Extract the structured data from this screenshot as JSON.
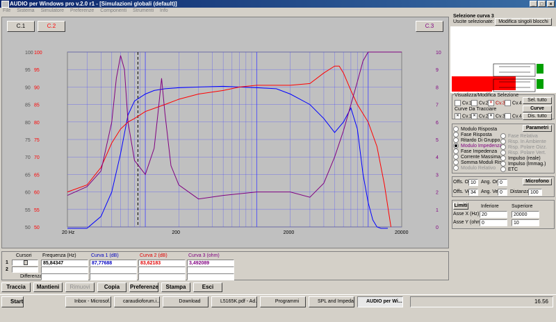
{
  "window": {
    "title": "AUDIO per Windows pro v.2.0 r1 - [Simulazioni globali (default)]"
  },
  "menu": [
    "File",
    "Sistema",
    "Simulatore",
    "Preferenze",
    "Componenti",
    "Strumenti",
    "Info"
  ],
  "legend": {
    "c1": "C.1",
    "c2": "C.2",
    "c3": "C.3"
  },
  "chart_data": {
    "type": "line",
    "x_scale": "log",
    "xlim": [
      20,
      20000
    ],
    "xticks": [
      "20 Hz",
      "200",
      "2000",
      "20000"
    ],
    "ylim_left": [
      50,
      100
    ],
    "ylim_right": [
      0,
      10
    ],
    "yticks_left_gray": [
      "100",
      "95",
      "90",
      "85",
      "80",
      "75",
      "70",
      "65",
      "60",
      "55",
      "50"
    ],
    "yticks_left_red": [
      "100",
      "95",
      "90",
      "85",
      "80",
      "75",
      "70",
      "65",
      "60",
      "55",
      "50"
    ],
    "yticks_right": [
      "10",
      "9",
      "8",
      "7",
      "6",
      "5",
      "4",
      "3",
      "2",
      "1",
      "0"
    ],
    "cursor_x": 85.84,
    "grid": true,
    "series": [
      {
        "name": "Curva 1 (dB)",
        "color": "#0000ff",
        "axis": "left",
        "x": [
          20,
          30,
          40,
          50,
          60,
          70,
          80,
          100,
          120,
          150,
          200,
          300,
          500,
          700,
          1000,
          1500,
          2000,
          3000,
          4000,
          5000,
          6000,
          7000,
          8000,
          9000,
          10000,
          11000,
          12000,
          13000,
          15000
        ],
        "y": [
          47,
          49,
          53,
          60,
          71,
          82,
          86,
          88,
          89,
          89.5,
          89.8,
          90,
          90.2,
          90,
          89.8,
          89.5,
          88,
          85,
          81,
          77,
          80,
          84,
          78,
          65,
          57,
          52,
          50,
          49,
          48
        ]
      },
      {
        "name": "Curva 2 (dB)",
        "color": "#ff0000",
        "axis": "left",
        "x": [
          20,
          30,
          40,
          50,
          60,
          70,
          80,
          100,
          150,
          200,
          300,
          500,
          700,
          1000,
          1500,
          2000,
          3000,
          4000,
          5000,
          5500,
          6000,
          7000,
          8000,
          10000,
          12000,
          14000,
          16000
        ],
        "y": [
          60,
          62,
          67,
          74,
          78,
          80,
          81,
          83,
          85,
          86.5,
          88,
          89,
          90,
          90.5,
          90.5,
          90.5,
          91,
          94,
          96,
          96,
          94,
          89,
          85,
          80,
          73,
          62,
          50
        ]
      },
      {
        "name": "Curva 3 (ohm)",
        "color": "#800080",
        "axis": "right",
        "x": [
          20,
          30,
          40,
          50,
          55,
          60,
          65,
          70,
          80,
          100,
          120,
          130,
          140,
          150,
          170,
          200,
          300,
          500,
          1000,
          2000,
          3000,
          4000,
          5000,
          6000,
          7000,
          8000,
          9000,
          10000,
          15000,
          20000
        ],
        "y": [
          1.8,
          2.3,
          3.2,
          6,
          8.5,
          9.8,
          9,
          6,
          3.8,
          3,
          4.5,
          6.5,
          8.5,
          6.5,
          3.5,
          2.4,
          1.6,
          1.8,
          2,
          2,
          1.7,
          2.5,
          4,
          5.5,
          7,
          8.3,
          9.5,
          10,
          10,
          10
        ]
      }
    ]
  },
  "cursor": {
    "header": "Cursori",
    "row1": "1",
    "row2": "2",
    "diff_label": "Differenza",
    "col_freq": "Frequenza (Hz)",
    "col_c1": "Curva 1 (dB)",
    "col_c2": "Curva 2 (dB)",
    "col_c3": "Curva 3 (ohm)",
    "freq1": "85,84347",
    "c1_1": "87,77688",
    "c2_1": "83,62183",
    "c3_1": "3,492089"
  },
  "toolbar": {
    "traccia": "Traccia",
    "mantieni": "Mantieni",
    "rimuovi": "Rimuovi",
    "copia": "Copia",
    "preferenze": "Preferenze",
    "stampa": "Stampa",
    "esci": "Esci"
  },
  "right": {
    "sel_title": "Selezione curva 3",
    "uscite": "Uscite selezionate: 1",
    "modifica": "Modifica singoli blocchi",
    "vis_title": "Visualizza/Modifica Selezione",
    "cv": [
      "Cv.1",
      "Cv.2",
      "Cv.3",
      "Cv.4"
    ],
    "sel_tutto": "Sel. tutto",
    "curve_title": "Curve Da Tracciare",
    "curve_btn": "Curve",
    "dis_tutto": "Dis. tutto",
    "parametri": "Parametri",
    "params_left": [
      "Modulo Risposta",
      "Fase Risposta",
      "Ritardo Di Gruppo",
      "Modulo Impedenza",
      "Fase Impedenza",
      "Corrente Massima",
      "Somma Moduli Risp.",
      "Modulo Relativo"
    ],
    "params_right": [
      "Fase Relativa",
      "Risp. In Ambiente",
      "Risp. Polare Oizz.",
      "Risp. Polare Vert.",
      "Impulso (reale)",
      "Impulso (Immag.)",
      "ETC"
    ],
    "offs_or_label": "Offs. Or.",
    "offs_or": "10",
    "ang_or_label": "Ang. Or.",
    "ang_or": "0",
    "microfono": "Microfono",
    "offs_ve_label": "Offs. Ve.",
    "offs_ve": "34",
    "ang_ve_label": "Ang. Ve.",
    "ang_ve": "0",
    "distanza_label": "Distanza",
    "distanza": "100",
    "limiti": "Limiti",
    "inferiore": "Inferiore",
    "superiore": "Superiore",
    "asse_x": "Asse X  (Hz)",
    "x_inf": "20",
    "x_sup": "20000",
    "asse_y": "Asse Y  (ohm)",
    "y_inf": "0",
    "y_sup": "10"
  },
  "taskbar": {
    "start": "Start",
    "tasks": [
      "Inbox - Microsof...",
      "caraudioforum.i...",
      "Download",
      "L5165K.pdf - Ad...",
      "Programmi",
      "SPL and Impeda...",
      "AUDIO per Wi..."
    ],
    "clock": "16.56"
  }
}
